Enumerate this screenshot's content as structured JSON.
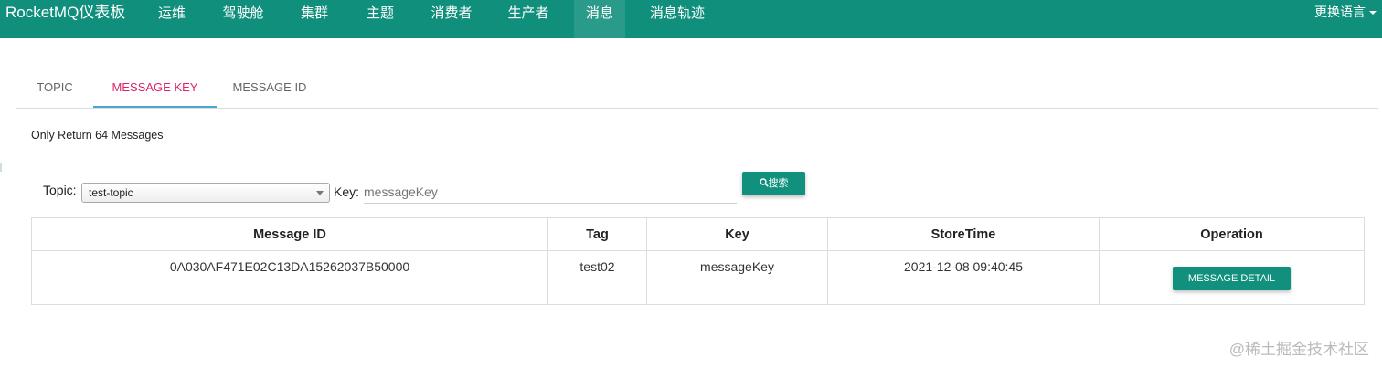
{
  "navbar": {
    "brand": "RocketMQ仪表板",
    "items": [
      "运维",
      "驾驶舱",
      "集群",
      "主题",
      "消费者",
      "生产者",
      "消息",
      "消息轨迹"
    ],
    "active_index": 6,
    "language": "更换语言",
    "color": "#108f7c"
  },
  "tabs": [
    "TOPIC",
    "MESSAGE KEY",
    "MESSAGE ID"
  ],
  "active_tab": 1,
  "info": "Only Return 64 Messages",
  "search": {
    "topic_label": "Topic:",
    "topic_value": "test-topic",
    "key_label": "Key:",
    "key_placeholder": "messageKey",
    "search_button": "搜索"
  },
  "table": {
    "headers": [
      "Message ID",
      "Tag",
      "Key",
      "StoreTime",
      "Operation"
    ],
    "rows": [
      {
        "message_id": "0A030AF471E02C13DA15262037B50000",
        "tag": "test02",
        "key": "messageKey",
        "store_time": "2021-12-08 09:40:45",
        "operation": "MESSAGE DETAIL"
      }
    ]
  },
  "watermark": "@稀土掘金技术社区"
}
